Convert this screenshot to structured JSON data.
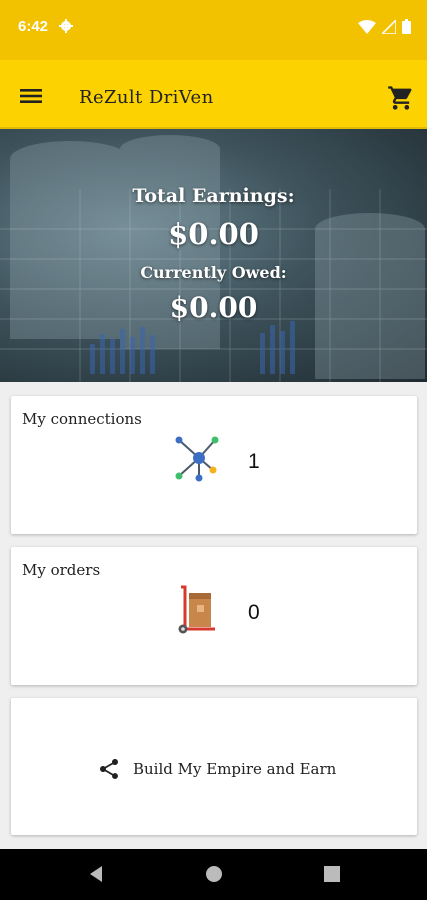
{
  "status_bar": {
    "time": "6:42",
    "icons": [
      "gear-icon",
      "wifi-icon",
      "signal-icon",
      "battery-icon"
    ]
  },
  "app_bar": {
    "title": "ReZult DriVen",
    "icons": [
      "menu-icon",
      "cart-icon"
    ]
  },
  "hero": {
    "total_earnings_label": "Total Earnings:",
    "total_earnings_value": "$0.00",
    "currently_owed_label": "Currently Owed:",
    "currently_owed_value": "$0.00"
  },
  "cards": {
    "connections": {
      "label": "My connections",
      "count": "1",
      "icon": "network-icon"
    },
    "orders": {
      "label": "My orders",
      "count": "0",
      "icon": "hand-truck-icon"
    },
    "share": {
      "label": "Build My Empire and Earn",
      "icon": "share-icon"
    }
  },
  "nav_bar": {
    "icons": [
      "back-icon",
      "home-icon",
      "recents-icon"
    ]
  },
  "colors": {
    "status_bar": "#f2c200",
    "app_bar": "#fcd300",
    "background": "#efefef",
    "card": "#ffffff",
    "nav_bar": "#000000"
  }
}
